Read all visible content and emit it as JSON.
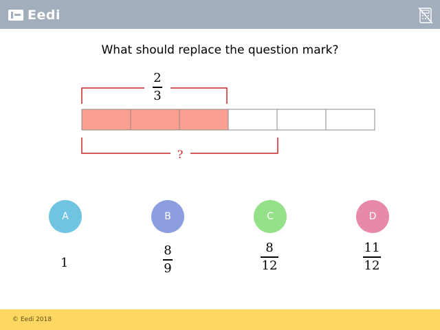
{
  "header": {
    "logo_text": "Eedi",
    "logo_icon": "eedi-logo-icon",
    "calculator_icon": "calculator-disabled-icon",
    "bar_color": "#a2aebc"
  },
  "question": {
    "text": "What should replace the question mark?"
  },
  "diagram": {
    "top_fraction": {
      "numerator": "2",
      "denominator": "3"
    },
    "bottom_label": "?",
    "total_parts": 6,
    "shaded_parts": 3,
    "shade_color": "#fd9f92",
    "bracket_color": "#cc2222"
  },
  "options": [
    {
      "letter": "A",
      "color": "#70c3e1",
      "answer": {
        "type": "whole",
        "value": "1"
      }
    },
    {
      "letter": "B",
      "color": "#8d9ee0",
      "answer": {
        "type": "fraction",
        "numerator": "8",
        "denominator": "9"
      }
    },
    {
      "letter": "C",
      "color": "#95e18a",
      "answer": {
        "type": "fraction",
        "numerator": "8",
        "denominator": "12"
      }
    },
    {
      "letter": "D",
      "color": "#e68aa8",
      "answer": {
        "type": "fraction",
        "numerator": "11",
        "denominator": "12"
      }
    }
  ],
  "footer": {
    "copyright": "© Eedi 2018",
    "bar_color": "#fed762"
  }
}
